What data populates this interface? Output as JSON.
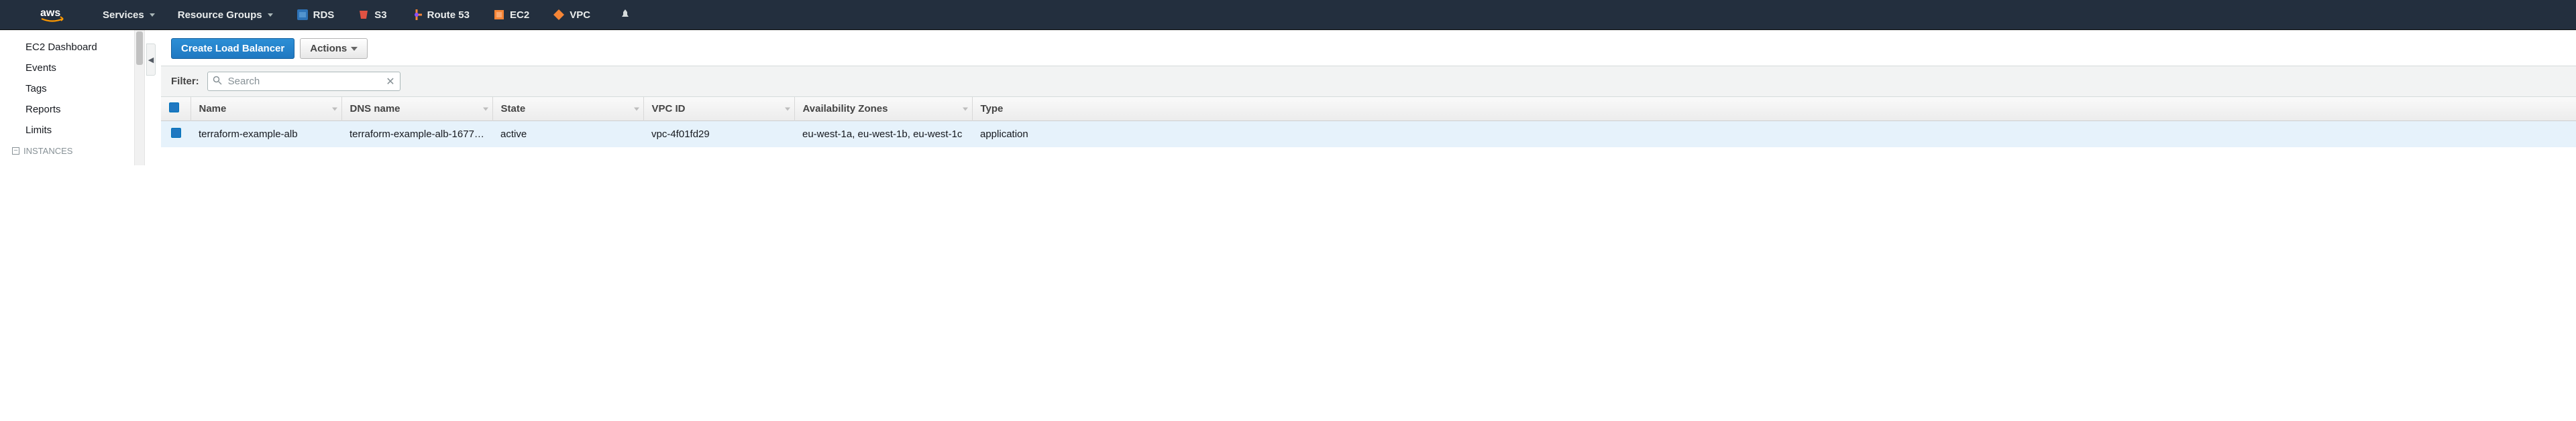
{
  "top_nav": {
    "services_label": "Services",
    "resource_groups_label": "Resource Groups",
    "shortcuts": [
      {
        "label": "RDS",
        "icon": "rds"
      },
      {
        "label": "S3",
        "icon": "s3"
      },
      {
        "label": "Route 53",
        "icon": "route53"
      },
      {
        "label": "EC2",
        "icon": "ec2"
      },
      {
        "label": "VPC",
        "icon": "vpc"
      }
    ]
  },
  "sidebar": {
    "items": [
      "EC2 Dashboard",
      "Events",
      "Tags",
      "Reports",
      "Limits"
    ],
    "section_label": "INSTANCES"
  },
  "toolbar": {
    "create_label": "Create Load Balancer",
    "actions_label": "Actions"
  },
  "filter": {
    "label": "Filter:",
    "placeholder": "Search"
  },
  "table": {
    "columns": [
      "Name",
      "DNS name",
      "State",
      "VPC ID",
      "Availability Zones",
      "Type"
    ],
    "rows": [
      {
        "selected": true,
        "name": "terraform-example-alb",
        "dns_name": "terraform-example-alb-1677…",
        "state": "active",
        "vpc_id": "vpc-4f01fd29",
        "availability_zones": "eu-west-1a, eu-west-1b, eu-west-1c",
        "type": "application"
      }
    ]
  }
}
